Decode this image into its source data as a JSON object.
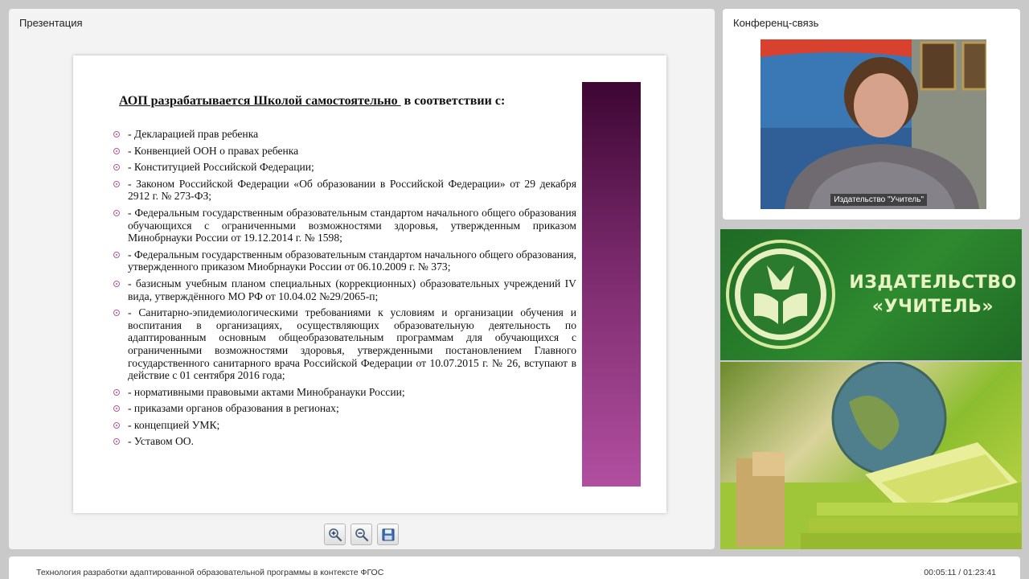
{
  "presentation_panel": {
    "title": "Презентация"
  },
  "conference_panel": {
    "title": "Конференц-связь",
    "video_caption": "Издательство \"Учитель\""
  },
  "slide": {
    "heading_underlined": "АОП разрабатывается Школой самостоятельно ",
    "heading_rest": " в соответствии с:",
    "items": [
      "- Декларацией прав ребенка",
      "- Конвенцией ООН о правах ребенка",
      "- Конституцией Российской Федерации;",
      "- Законом Российской Федерации «Об образовании в Российской Федерации» от 29 декабря 2912 г. № 273-ФЗ;",
      "- Федеральным государственным образовательным стандартом начального общего образования обучающихся с ограниченными возможностями здоровья, утвержденным приказом Минобрнауки России от 19.12.2014 г. № 1598;",
      "- Федеральным государственным образовательным стандартом начального общего образования, утвержденного приказом Миобрнауки России от 06.10.2009 г. № 373;",
      "- базисным учебным планом специальных (коррекционных) образовательных учреждений IV вида, утверждённого МО РФ от 10.04.02 №29/2065-п;",
      "- Санитарно-эпидемиологическими требованиями к условиям и организации обучения и воспитания в организациях, осуществляющих образовательную деятельность по адаптированным основным общеобразовательным программам для обучающихся с ограниченными возможностями здоровья, утвержденными постановлением Главного государственного санитарного врача Российской Федерации от 10.07.2015 г. № 26, вступают в действие с 01 сентября 2016 года;",
      "- нормативными правовыми актами Минобранауки России;",
      "- приказами органов образования в регионах;",
      "- концепцией УМК;",
      "- Уставом ОО."
    ]
  },
  "toolbar": {
    "icons": [
      "zoom-in-icon",
      "zoom-out-icon",
      "save-icon"
    ]
  },
  "publisher": {
    "line1": "ИЗДАТЕЛЬСТВО",
    "line2": "«УЧИТЕЛЬ»"
  },
  "footer": {
    "title": "Технология разработки адаптированной образовательной программы в контексте ФГОС",
    "time": "00:05:11 / 01:23:41"
  },
  "colors": {
    "accent_purple": "#b24fa0",
    "publisher_green": "#2e8a2f"
  }
}
